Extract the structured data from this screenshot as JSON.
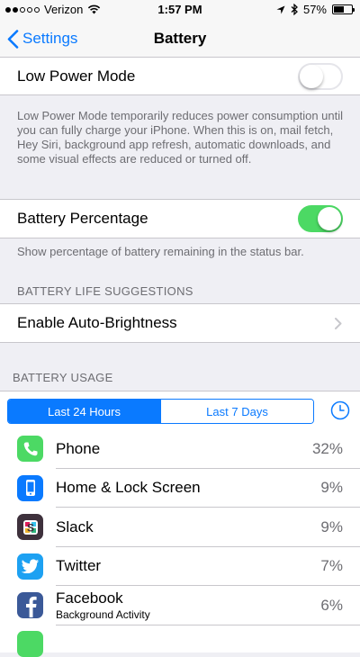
{
  "status_bar": {
    "carrier": "Verizon",
    "signal_bars_filled": 2,
    "signal_bars_total": 5,
    "time": "1:57 PM",
    "battery_percent": "57%",
    "battery_level": 0.57
  },
  "nav": {
    "back_label": "Settings",
    "title": "Battery"
  },
  "low_power": {
    "label": "Low Power Mode",
    "enabled": false,
    "footnote": "Low Power Mode temporarily reduces power consumption until you can fully charge your iPhone. When this is on, mail fetch, Hey Siri, background app refresh, automatic downloads, and some visual effects are reduced or turned off."
  },
  "battery_percentage": {
    "label": "Battery Percentage",
    "enabled": true,
    "footnote": "Show percentage of battery remaining in the status bar."
  },
  "suggestions": {
    "header": "BATTERY LIFE SUGGESTIONS",
    "item_label": "Enable Auto-Brightness"
  },
  "usage": {
    "header": "BATTERY USAGE",
    "tabs": [
      "Last 24 Hours",
      "Last 7 Days"
    ],
    "active_tab": 0,
    "apps": [
      {
        "name": "Phone",
        "subtitle": "",
        "percent": "32%",
        "icon": "phone-icon",
        "color": "#4cd964"
      },
      {
        "name": "Home & Lock Screen",
        "subtitle": "",
        "percent": "9%",
        "icon": "home-screen-icon",
        "color": "#0a7aff"
      },
      {
        "name": "Slack",
        "subtitle": "",
        "percent": "9%",
        "icon": "slack-icon",
        "color": "#3e313c"
      },
      {
        "name": "Twitter",
        "subtitle": "",
        "percent": "7%",
        "icon": "twitter-icon",
        "color": "#1da1f2"
      },
      {
        "name": "Facebook",
        "subtitle": "Background Activity",
        "percent": "6%",
        "icon": "facebook-icon",
        "color": "#3b5998"
      }
    ]
  },
  "colors": {
    "accent": "#0a7aff",
    "toggle_on": "#4cd964",
    "background": "#efeff4"
  }
}
